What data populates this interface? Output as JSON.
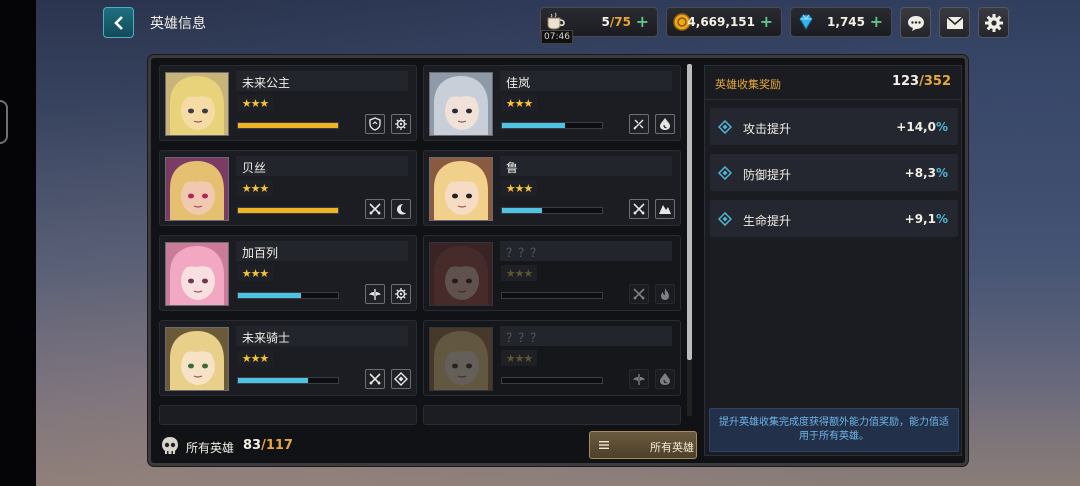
{
  "header": {
    "title": "英雄信息",
    "resources": [
      {
        "name": "stamina",
        "icon": "coffee-cup-icon",
        "value": "5",
        "max": "75",
        "timer": "07:46"
      },
      {
        "name": "gold",
        "icon": "gold-coin-icon",
        "value": "4,669,151"
      },
      {
        "name": "gems",
        "icon": "diamond-icon",
        "value": "1,745"
      }
    ]
  },
  "heroes": [
    {
      "name": "未来公主",
      "stars": "★★★",
      "progress": 1.0,
      "bar_color": "#f0b324",
      "locked": false,
      "icons": [
        "shield-icon",
        "gear-icon"
      ]
    },
    {
      "name": "佳岚",
      "stars": "★★★",
      "progress": 0.63,
      "bar_color": "#4ec3e3",
      "locked": false,
      "icons": [
        "no-sword-icon",
        "water-drop-icon"
      ]
    },
    {
      "name": "贝丝",
      "stars": "★★★",
      "progress": 1.0,
      "bar_color": "#f0b324",
      "locked": false,
      "icons": [
        "crossed-swords-icon",
        "moon-icon"
      ]
    },
    {
      "name": "鲁",
      "stars": "★★★",
      "progress": 0.4,
      "bar_color": "#4ec3e3",
      "locked": false,
      "icons": [
        "crossed-swords-icon",
        "mountain-icon"
      ]
    },
    {
      "name": "加百列",
      "stars": "★★★",
      "progress": 0.63,
      "bar_color": "#4ec3e3",
      "locked": false,
      "icons": [
        "wings-icon",
        "gear-icon"
      ]
    },
    {
      "name": "？？？",
      "stars": "★★★",
      "progress": 0,
      "bar_color": "#4ec3e3",
      "locked": true,
      "icons": [
        "crossed-swords-icon",
        "flame-icon"
      ]
    },
    {
      "name": "未来骑士",
      "stars": "★★★",
      "progress": 0.7,
      "bar_color": "#4ec3e3",
      "locked": false,
      "icons": [
        "crossed-swords-icon",
        "diamond-shield-icon"
      ]
    },
    {
      "name": "？？？",
      "stars": "★★★",
      "progress": 0,
      "bar_color": "#4ec3e3",
      "locked": true,
      "icons": [
        "wings-icon",
        "water-drop-icon"
      ]
    }
  ],
  "footer": {
    "label": "所有英雄",
    "count": "83",
    "max": "117",
    "filter_label": "所有英雄"
  },
  "collection": {
    "title": "英雄收集奖励",
    "count": "123",
    "max": "352",
    "bonuses": [
      {
        "label": "攻击提升",
        "value": "+14,0",
        "unit": "%"
      },
      {
        "label": "防御提升",
        "value": "+8,3",
        "unit": "%"
      },
      {
        "label": "生命提升",
        "value": "+9,1",
        "unit": "%"
      }
    ],
    "note": "提升英雄收集完成度获得额外能力值奖励，能力值适用于所有英雄。"
  },
  "colors": {
    "accent_gold": "#e7a83a",
    "accent_blue": "#4fb6d6",
    "plus_green": "#5fc48a"
  }
}
